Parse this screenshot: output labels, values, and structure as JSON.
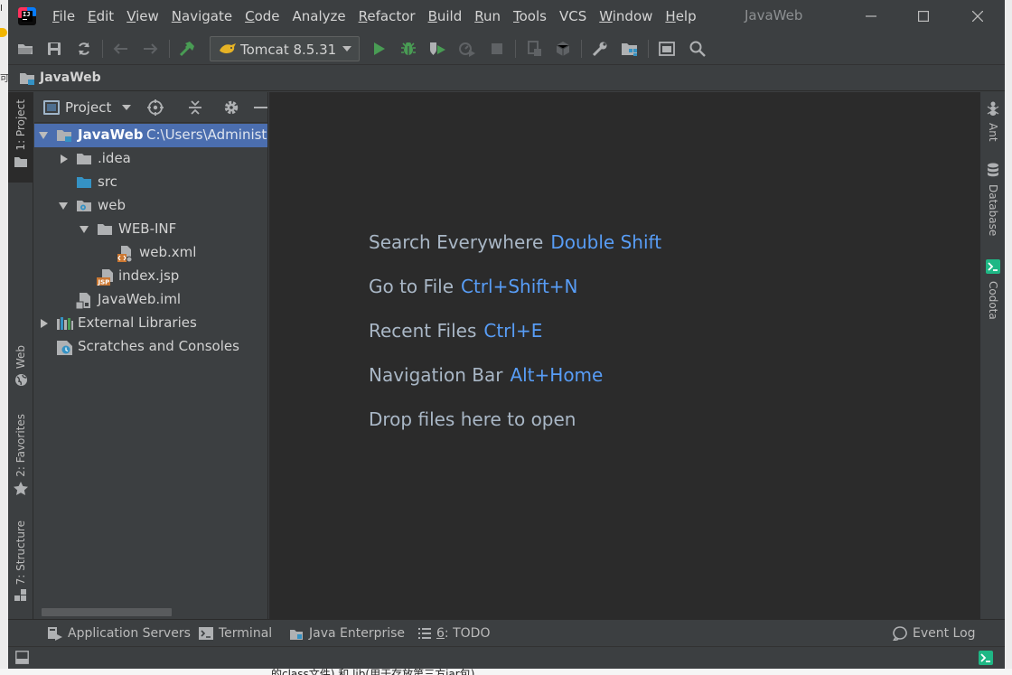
{
  "titlebar": {
    "window_title": "JavaWeb",
    "menu": [
      {
        "mn": "F",
        "rest": "ile"
      },
      {
        "mn": "E",
        "rest": "dit"
      },
      {
        "mn": "V",
        "rest": "iew"
      },
      {
        "mn": "N",
        "rest": "avigate"
      },
      {
        "mn": "C",
        "rest": "ode"
      },
      {
        "mn": "",
        "rest": "Analyze"
      },
      {
        "mn": "R",
        "rest": "efactor"
      },
      {
        "mn": "B",
        "rest": "uild"
      },
      {
        "mn": "R",
        "rest": "un"
      },
      {
        "mn": "T",
        "rest": "ools"
      },
      {
        "mn": "",
        "rest": "VCS"
      },
      {
        "mn": "W",
        "rest": "indow"
      },
      {
        "mn": "H",
        "rest": "elp"
      }
    ]
  },
  "toolbar": {
    "run_config": "Tomcat 8.5.31"
  },
  "navbar": {
    "crumb": "JavaWeb"
  },
  "left_stripe": {
    "project": "1: Project",
    "web": "Web",
    "favorites": "2: Favorites",
    "structure": "7: Structure"
  },
  "project_panel": {
    "title": "Project",
    "tree": [
      {
        "label": "JavaWeb",
        "path": "C:\\Users\\Administrator\\IdeaProjects\\JavaWeb",
        "level": 0,
        "arrow": "open",
        "icon": "module-folder-icon",
        "selected": true
      },
      {
        "label": ".idea",
        "level": 1,
        "arrow": "closed",
        "icon": "folder-icon"
      },
      {
        "label": "src",
        "level": 1,
        "arrow": "",
        "icon": "source-folder-icon"
      },
      {
        "label": "web",
        "level": 1,
        "arrow": "open",
        "icon": "web-folder-icon"
      },
      {
        "label": "WEB-INF",
        "level": 2,
        "arrow": "open",
        "icon": "folder-icon"
      },
      {
        "label": "web.xml",
        "level": 3,
        "arrow": "",
        "icon": "xml-file-icon"
      },
      {
        "label": "index.jsp",
        "level": 2,
        "arrow": "",
        "icon": "jsp-file-icon"
      },
      {
        "label": "JavaWeb.iml",
        "level": 1,
        "arrow": "",
        "icon": "iml-file-icon"
      },
      {
        "label": "External Libraries",
        "level": 0,
        "arrow": "closed",
        "icon": "libraries-icon"
      },
      {
        "label": "Scratches and Consoles",
        "level": 0,
        "arrow": "",
        "icon": "scratches-icon"
      }
    ]
  },
  "editor": {
    "hints": [
      {
        "text": "Search Everywhere",
        "key": "Double Shift"
      },
      {
        "text": "Go to File",
        "key": "Ctrl+Shift+N"
      },
      {
        "text": "Recent Files",
        "key": "Ctrl+E"
      },
      {
        "text": "Navigation Bar",
        "key": "Alt+Home"
      },
      {
        "text": "Drop files here to open",
        "key": ""
      }
    ]
  },
  "right_stripe": {
    "ant": "Ant",
    "database": "Database",
    "codota": "Codota"
  },
  "bottom_tools": {
    "app_servers": "Application Servers",
    "terminal": "Terminal",
    "java_enterprise": "Java Enterprise",
    "todo_mn": "6",
    "todo_rest": ": TODO",
    "event_log": "Event Log"
  },
  "background_text": "的class文件) 和 lib(用于存放第三方jar包)",
  "colors": {
    "background": "#3c3f41",
    "editor": "#2b2b2b",
    "selection": "#4b6eaf",
    "shortcut": "#589df6",
    "run_green": "#499c54"
  }
}
